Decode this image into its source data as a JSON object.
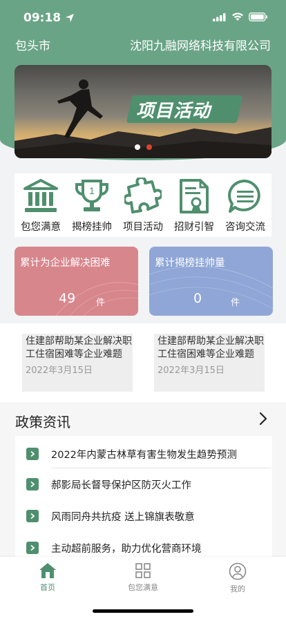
{
  "status": {
    "time": "09:18"
  },
  "header": {
    "city": "包头市",
    "company": "沈阳九融网络科技有限公司"
  },
  "banner": {
    "title": "项目活动",
    "active_dot": 1
  },
  "quick_nav": [
    {
      "label": "包您满意",
      "icon": "bank-icon"
    },
    {
      "label": "揭榜挂帅",
      "icon": "trophy-icon"
    },
    {
      "label": "项目活动",
      "icon": "puzzle-icon"
    },
    {
      "label": "招财引智",
      "icon": "certificate-icon"
    },
    {
      "label": "咨询交流",
      "icon": "chat-icon"
    }
  ],
  "stats": [
    {
      "title": "累计为企业解决困难",
      "value": "49",
      "unit": "件"
    },
    {
      "title": "累计揭榜挂帅量",
      "value": "0",
      "unit": "件"
    }
  ],
  "news": [
    {
      "title": "住建部帮助某企业解决职工住宿困难等企业难题",
      "date": "2022年3月15日"
    },
    {
      "title": "住建部帮助某企业解决职工住宿困难等企业难题",
      "date": "2022年3月15日"
    }
  ],
  "policy": {
    "title": "政策资讯",
    "items": [
      "2022年内蒙古林草有害生物发生趋势预测",
      "郝影局长督导保护区防灭火工作",
      "风雨同舟共抗疫 送上锦旗表敬意",
      "主动超前服务，助力优化营商环境"
    ]
  },
  "tabbar": [
    {
      "label": "首页",
      "icon": "home-icon"
    },
    {
      "label": "包您满意",
      "icon": "grid-icon"
    },
    {
      "label": "我的",
      "icon": "user-icon"
    }
  ],
  "colors": {
    "primary": "#6aa486",
    "accent": "#4f8f6e",
    "stat_red": "#d7868c",
    "stat_blue": "#8fa6d6"
  }
}
